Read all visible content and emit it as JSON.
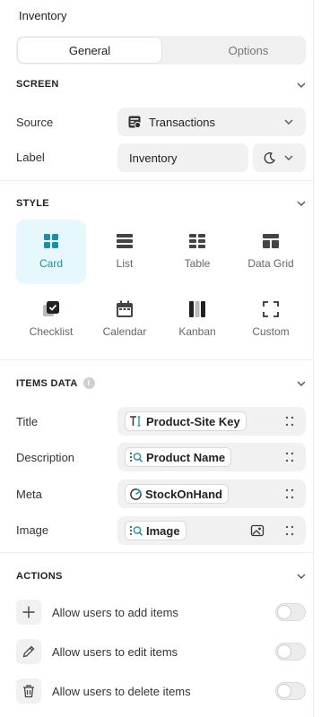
{
  "panel": {
    "title": "Inventory"
  },
  "tabs": {
    "general": "General",
    "options": "Options"
  },
  "screen": {
    "heading": "SCREEN",
    "source_label": "Source",
    "source_value": "Transactions",
    "label_label": "Label",
    "label_value": "Inventory"
  },
  "style": {
    "heading": "STYLE",
    "options": [
      "Card",
      "List",
      "Table",
      "Data Grid",
      "Checklist",
      "Calendar",
      "Kanban",
      "Custom"
    ],
    "selected": "Card"
  },
  "items_data": {
    "heading": "ITEMS DATA",
    "info_glyph": "i",
    "rows": [
      {
        "label": "Title",
        "value": "Product-Site Key",
        "icon": "text-field-icon"
      },
      {
        "label": "Description",
        "value": "Product Name",
        "icon": "lookup-icon"
      },
      {
        "label": "Meta",
        "value": "StockOnHand",
        "icon": "rollup-icon"
      },
      {
        "label": "Image",
        "value": "Image",
        "icon": "lookup-icon"
      }
    ]
  },
  "actions": {
    "heading": "ACTIONS",
    "rows": [
      {
        "label": "Allow users to add items",
        "icon": "plus-icon",
        "enabled": false
      },
      {
        "label": "Allow users to edit items",
        "icon": "pencil-icon",
        "enabled": false
      },
      {
        "label": "Allow users to delete items",
        "icon": "trash-icon",
        "enabled": false
      }
    ]
  },
  "colors": {
    "accent": "#1a8fa6",
    "accent_bg": "#e6f8fb",
    "field_bg": "#f1f1f1"
  }
}
